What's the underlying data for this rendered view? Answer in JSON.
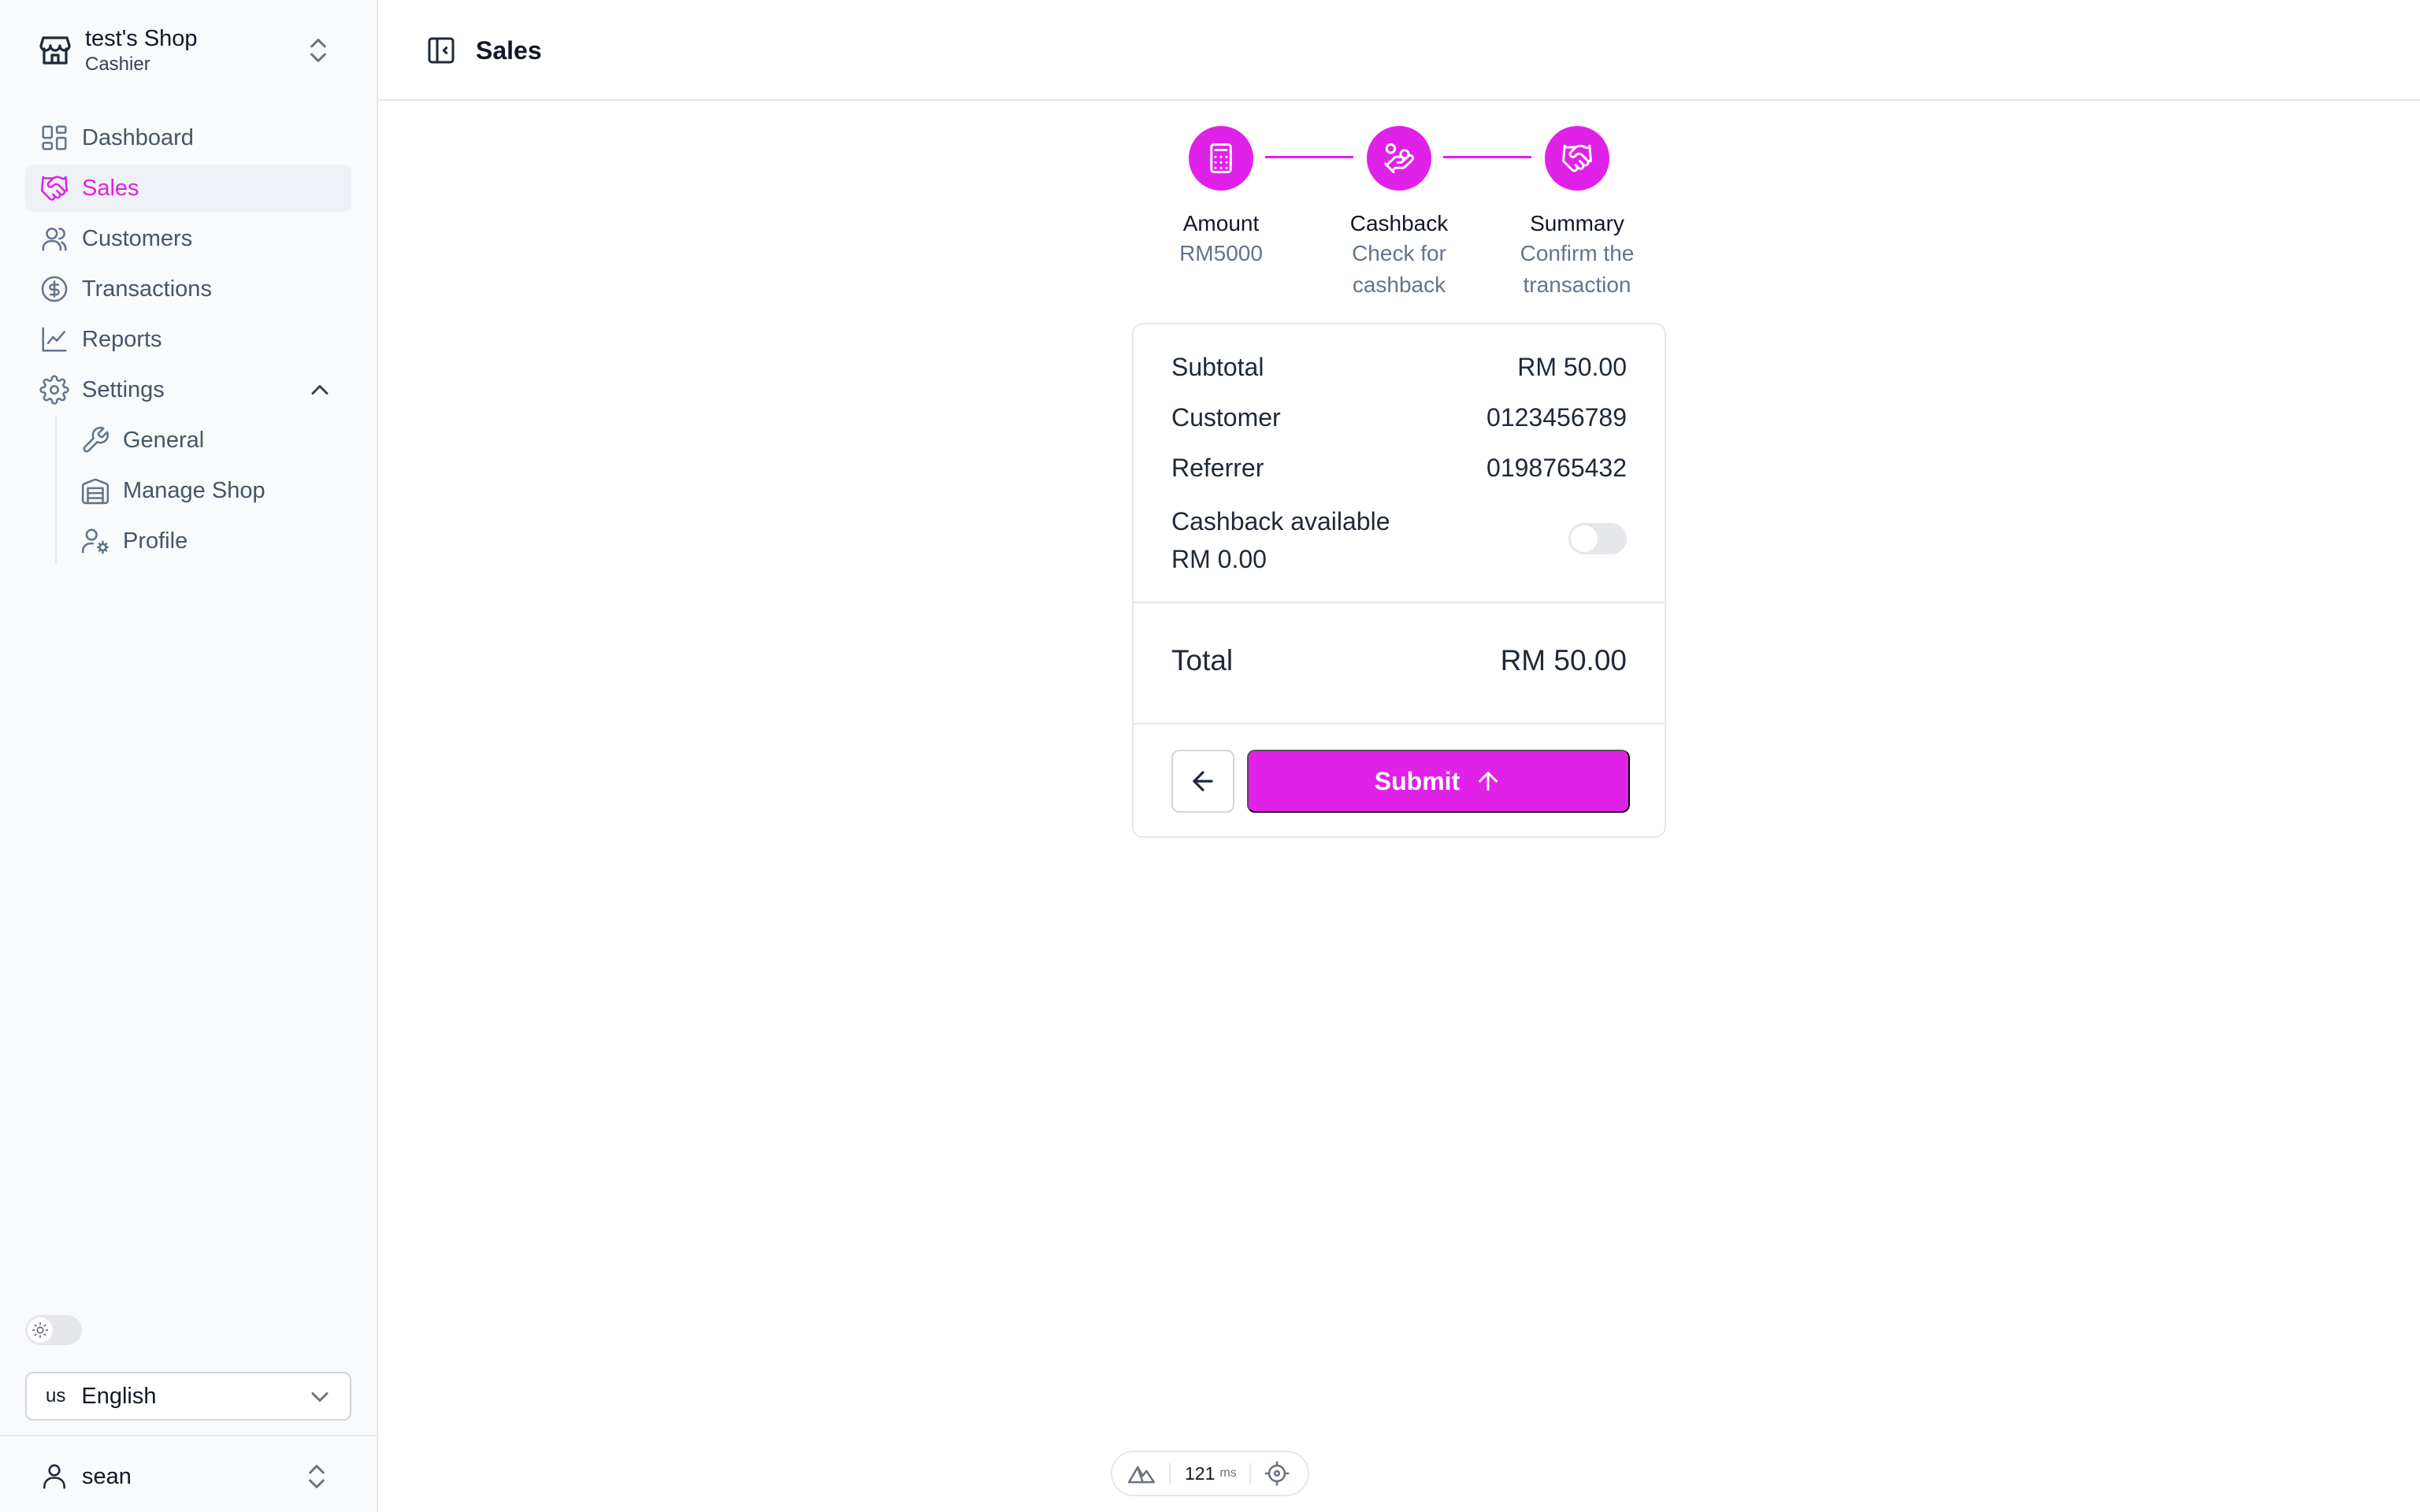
{
  "shop": {
    "name": "test's Shop",
    "role": "Cashier"
  },
  "nav": {
    "items": [
      {
        "label": "Dashboard",
        "icon": "dashboard-icon"
      },
      {
        "label": "Sales",
        "icon": "handshake-icon",
        "active": true
      },
      {
        "label": "Customers",
        "icon": "users-icon"
      },
      {
        "label": "Transactions",
        "icon": "dollar-circle-icon"
      },
      {
        "label": "Reports",
        "icon": "line-chart-icon"
      },
      {
        "label": "Settings",
        "icon": "gear-icon",
        "expanded": true
      }
    ],
    "settings_children": [
      {
        "label": "General",
        "icon": "wrench-icon"
      },
      {
        "label": "Manage Shop",
        "icon": "warehouse-icon"
      },
      {
        "label": "Profile",
        "icon": "user-cog-icon"
      }
    ]
  },
  "language": {
    "code": "us",
    "name": "English"
  },
  "user": {
    "name": "sean"
  },
  "header": {
    "title": "Sales"
  },
  "stepper": {
    "steps": [
      {
        "title": "Amount",
        "desc": "RM5000",
        "icon": "calculator-icon"
      },
      {
        "title": "Cashback",
        "desc": "Check for cashback",
        "icon": "hand-coins-icon"
      },
      {
        "title": "Summary",
        "desc": "Confirm the transaction",
        "icon": "handshake-icon"
      }
    ]
  },
  "summary": {
    "subtotal_label": "Subtotal",
    "subtotal_value": "RM 50.00",
    "customer_label": "Customer",
    "customer_value": "0123456789",
    "referrer_label": "Referrer",
    "referrer_value": "0198765432",
    "cashback_label": "Cashback available",
    "cashback_value": "RM 0.00",
    "cashback_enabled": false,
    "total_label": "Total",
    "total_value": "RM 50.00",
    "submit_label": "Submit"
  },
  "perf": {
    "value": "121",
    "unit": "ms"
  },
  "colors": {
    "accent": "#e021e8",
    "muted": "#64748b",
    "border": "#e5e7eb"
  }
}
